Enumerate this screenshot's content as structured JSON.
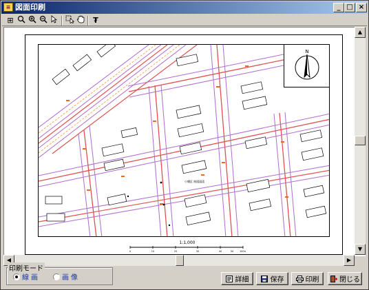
{
  "window": {
    "title": "図面印刷",
    "minimize": "_",
    "maximize": "□",
    "close": "×"
  },
  "toolbar": {
    "items": [
      {
        "name": "zoom-fit-icon",
        "glyph": "⊞"
      },
      {
        "name": "zoom-icon",
        "glyph": "🔍"
      },
      {
        "name": "zoom-in-icon",
        "glyph": "⊕"
      },
      {
        "name": "zoom-out-icon",
        "glyph": "⊖"
      },
      {
        "name": "pointer-icon",
        "glyph": "↖"
      },
      {
        "name": "select-area-icon",
        "glyph": "⬚"
      },
      {
        "name": "hand-pan-icon",
        "glyph": "✋"
      },
      {
        "name": "filter-icon",
        "glyph": "₮"
      }
    ]
  },
  "map": {
    "center_label": "小幡区 制図図面",
    "north_arrow": "N",
    "scale_title": "1:1,000",
    "scale_ticks": [
      "0",
      "10",
      "20",
      "30",
      "40",
      "50",
      "100m"
    ]
  },
  "print_mode": {
    "legend": "印刷モード",
    "options": [
      {
        "label": "線画",
        "selected": true
      },
      {
        "label": "画像",
        "selected": false
      }
    ]
  },
  "buttons": {
    "detail": "詳細",
    "save": "保存",
    "print": "印刷",
    "close": "閉じる"
  }
}
